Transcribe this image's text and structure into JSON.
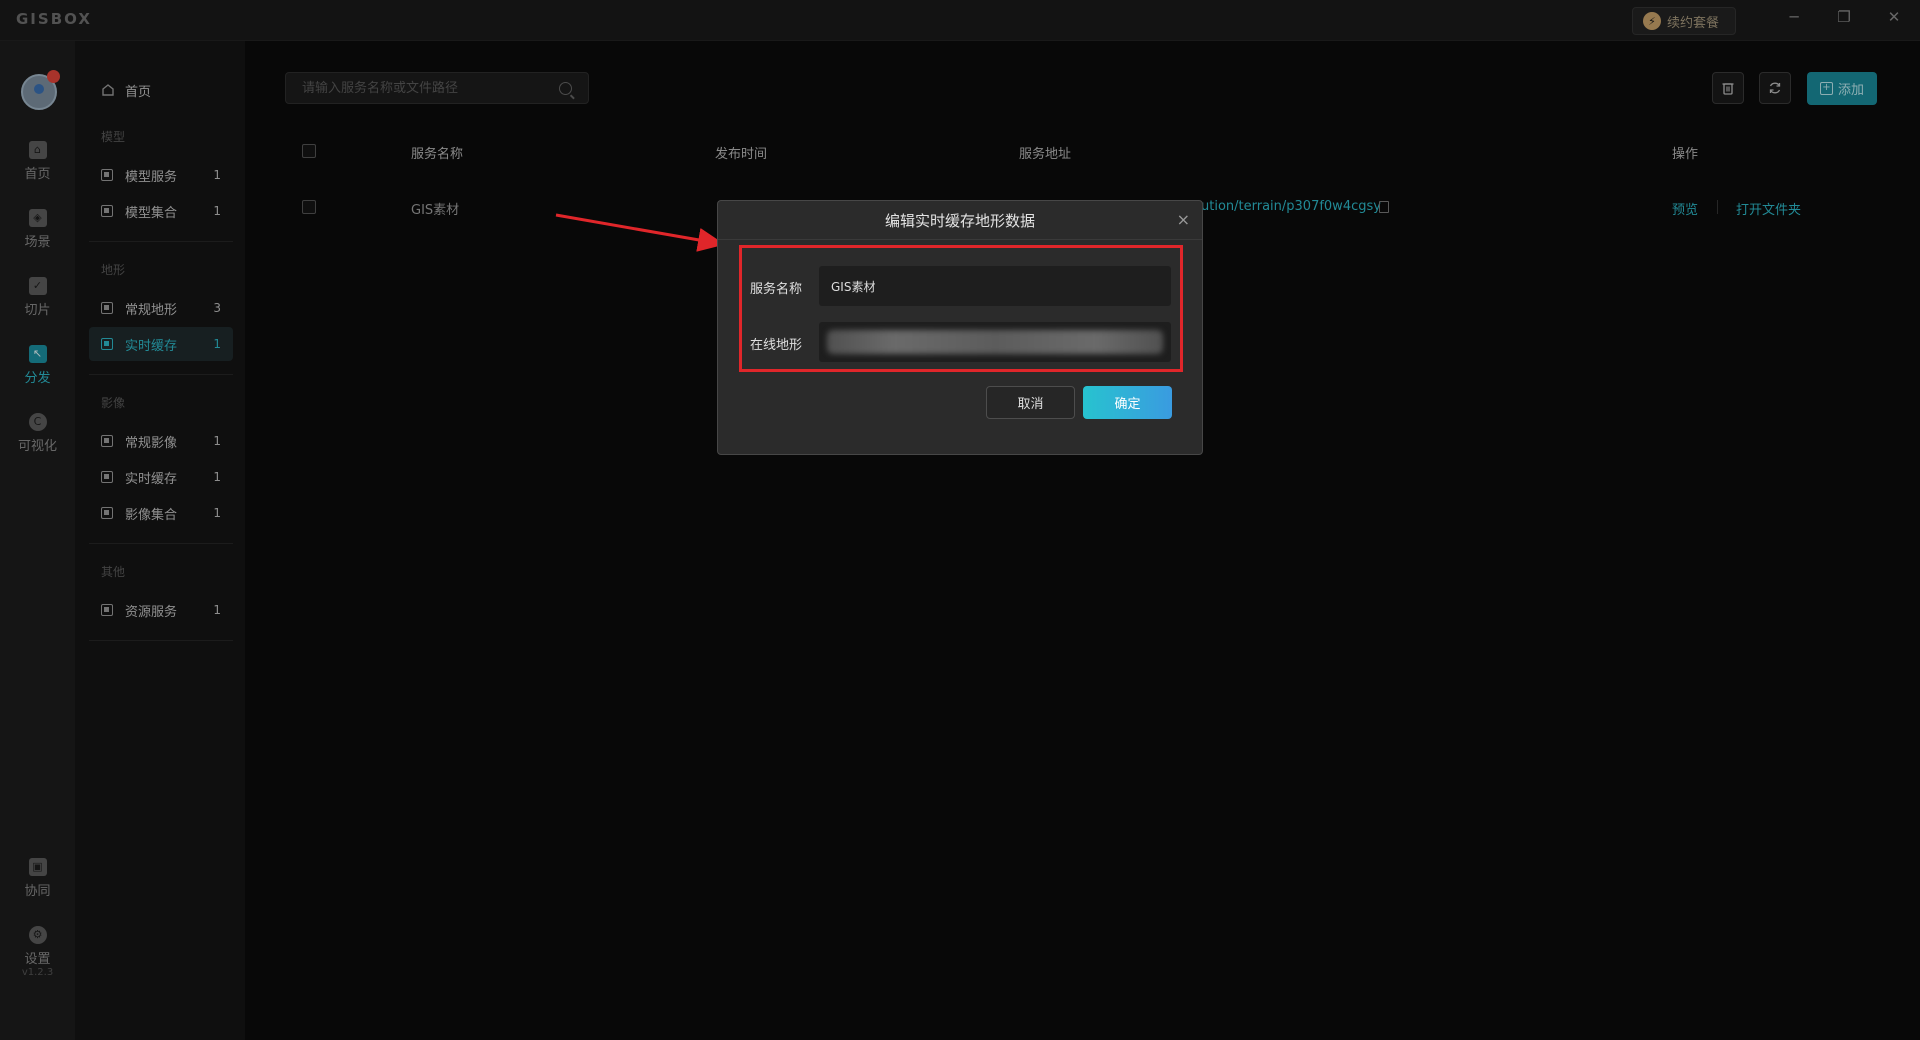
{
  "app": {
    "logo": "GISBOX",
    "renew_label": "续约套餐",
    "version": "v1.2.3"
  },
  "window_controls": {
    "minimize": "─",
    "restore": "❐",
    "close": "✕"
  },
  "iconbar": {
    "items": [
      {
        "label": "首页",
        "icon": "home-icon"
      },
      {
        "label": "场景",
        "icon": "cube-icon"
      },
      {
        "label": "切片",
        "icon": "slice-icon"
      },
      {
        "label": "分发",
        "icon": "distribute-icon"
      },
      {
        "label": "可视化",
        "icon": "visualize-icon"
      },
      {
        "label": "协同",
        "icon": "lock-icon"
      },
      {
        "label": "设置",
        "icon": "gear-icon"
      }
    ]
  },
  "sidebar": {
    "home": "首页",
    "groups": [
      {
        "title": "模型",
        "items": [
          {
            "label": "模型服务",
            "count": "1"
          },
          {
            "label": "模型集合",
            "count": "1"
          }
        ]
      },
      {
        "title": "地形",
        "items": [
          {
            "label": "常规地形",
            "count": "3"
          },
          {
            "label": "实时缓存",
            "count": "1"
          }
        ]
      },
      {
        "title": "影像",
        "items": [
          {
            "label": "常规影像",
            "count": "1"
          },
          {
            "label": "实时缓存",
            "count": "1"
          },
          {
            "label": "影像集合",
            "count": "1"
          }
        ]
      },
      {
        "title": "其他",
        "items": [
          {
            "label": "资源服务",
            "count": "1"
          }
        ]
      }
    ]
  },
  "toolbar": {
    "search_placeholder": "请输入服务名称或文件路径",
    "add_label": "添加"
  },
  "table": {
    "headers": {
      "name": "服务名称",
      "time": "发布时间",
      "address": "服务地址",
      "actions": "操作"
    },
    "rows": [
      {
        "name": "GIS素材",
        "address": "ution/terrain/p307f0w4cgsy",
        "preview": "预览",
        "open_folder": "打开文件夹"
      }
    ]
  },
  "dialog": {
    "title": "编辑实时缓存地形数据",
    "close": "×",
    "service_name_label": "服务名称",
    "service_name_value": "GIS素材",
    "online_terrain_label": "在线地形",
    "cancel": "取消",
    "confirm": "确定"
  },
  "colors": {
    "accent": "#2eb8c8",
    "highlight": "#e0262a"
  }
}
